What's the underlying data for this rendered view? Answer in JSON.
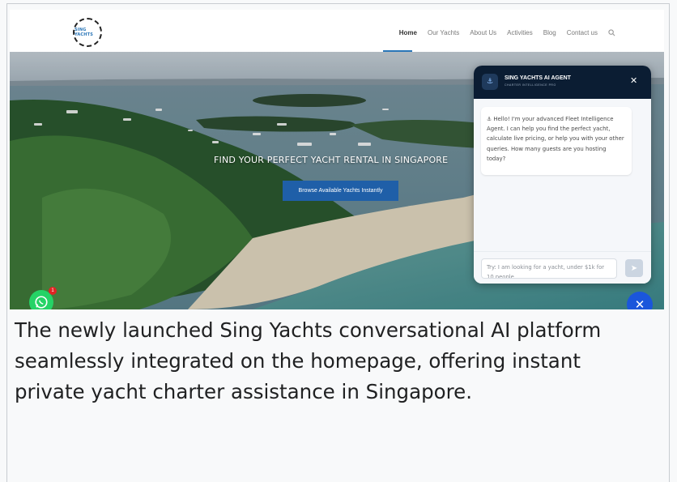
{
  "site": {
    "logo_text": "SING YACHTS",
    "nav": [
      {
        "label": "Home",
        "active": true
      },
      {
        "label": "Our Yachts",
        "active": false
      },
      {
        "label": "About Us",
        "active": false
      },
      {
        "label": "Activities",
        "active": false
      },
      {
        "label": "Blog",
        "active": false
      },
      {
        "label": "Contact us",
        "active": false
      }
    ],
    "search_icon": "search-icon"
  },
  "hero": {
    "title": "FIND YOUR PERFECT YACHT RENTAL IN SINGAPORE",
    "button_label": "Browse Available Yachts Instantly"
  },
  "chat": {
    "title": "SING YACHTS AI AGENT",
    "subtitle": "CHARTER INTELLIGENCE PRO",
    "avatar_icon": "anchor-icon",
    "close_icon": "close-icon",
    "message": "⚓ Hello! I'm your advanced Fleet Intelligence Agent. I can help you find the perfect yacht, calculate live pricing, or help you with your other queries. How many guests are you hosting today?",
    "input_placeholder": "Try: I am looking for a yacht, under $1k for 10 people",
    "send_icon": "send-icon"
  },
  "widgets": {
    "whatsapp_badge": "1",
    "close_fab_icon": "close-icon"
  },
  "caption": "The newly launched Sing Yachts conversational AI platform seamlessly integrated on the homepage, offering instant private yacht charter assistance in Singapore.",
  "colors": {
    "accent": "#1f5fa8",
    "chat_header": "#0b1d33",
    "whatsapp": "#25d366",
    "fab": "#1a56db"
  }
}
